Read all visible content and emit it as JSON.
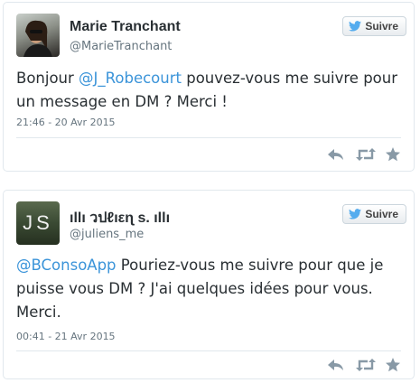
{
  "tweets": [
    {
      "name": "Marie Tranchant",
      "handle": "@MarieTranchant",
      "follow_label": "Suivre",
      "text_before": "Bonjour ",
      "mention": "@J_Robecourt",
      "text_after": " pouvez-vous me suivre pour un message en DM ? Merci !",
      "timestamp": "21:46 - 20 Avr 2015",
      "actions": [
        "reply-icon",
        "retweet-icon",
        "favorite-icon"
      ]
    },
    {
      "name": "ıllı วปℓıεɳ s. ıllı",
      "handle": "@juliens_me",
      "avatar_text": "JS",
      "follow_label": "Suivre",
      "text_before": "",
      "mention": "@BConsoApp",
      "text_after": " Pouriez-vous me suivre pour que je puisse vous DM ? J'ai quelques idées pour vous. Merci.",
      "timestamp": "00:41 - 21 Avr 2015",
      "actions": [
        "reply-icon",
        "retweet-icon",
        "favorite-icon"
      ]
    }
  ],
  "colors": {
    "link": "#3b94d9",
    "twitter_blue": "#55acee",
    "icon_gray": "#8899a6"
  }
}
